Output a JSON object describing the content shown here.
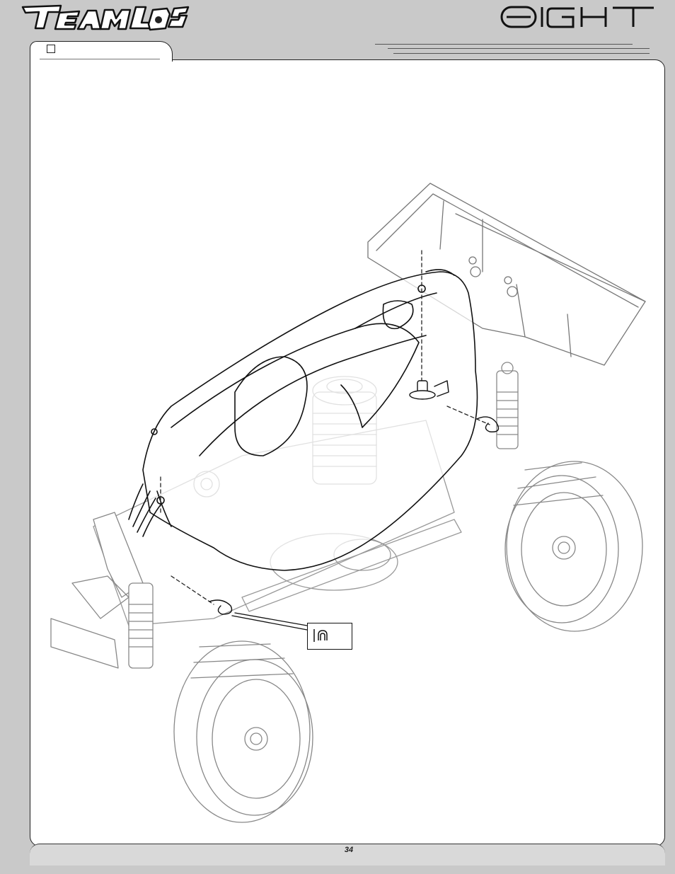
{
  "header": {
    "brand_left_logo": "TEAM LOSI",
    "brand_right_logo": "8IGHT",
    "step_checkbox_icon": "checkbox-icon"
  },
  "illustration": {
    "subject": "buggy-body-mounting-drawing",
    "callout_icon": "body-clip-icon"
  },
  "footer": {
    "page_number": "34"
  }
}
